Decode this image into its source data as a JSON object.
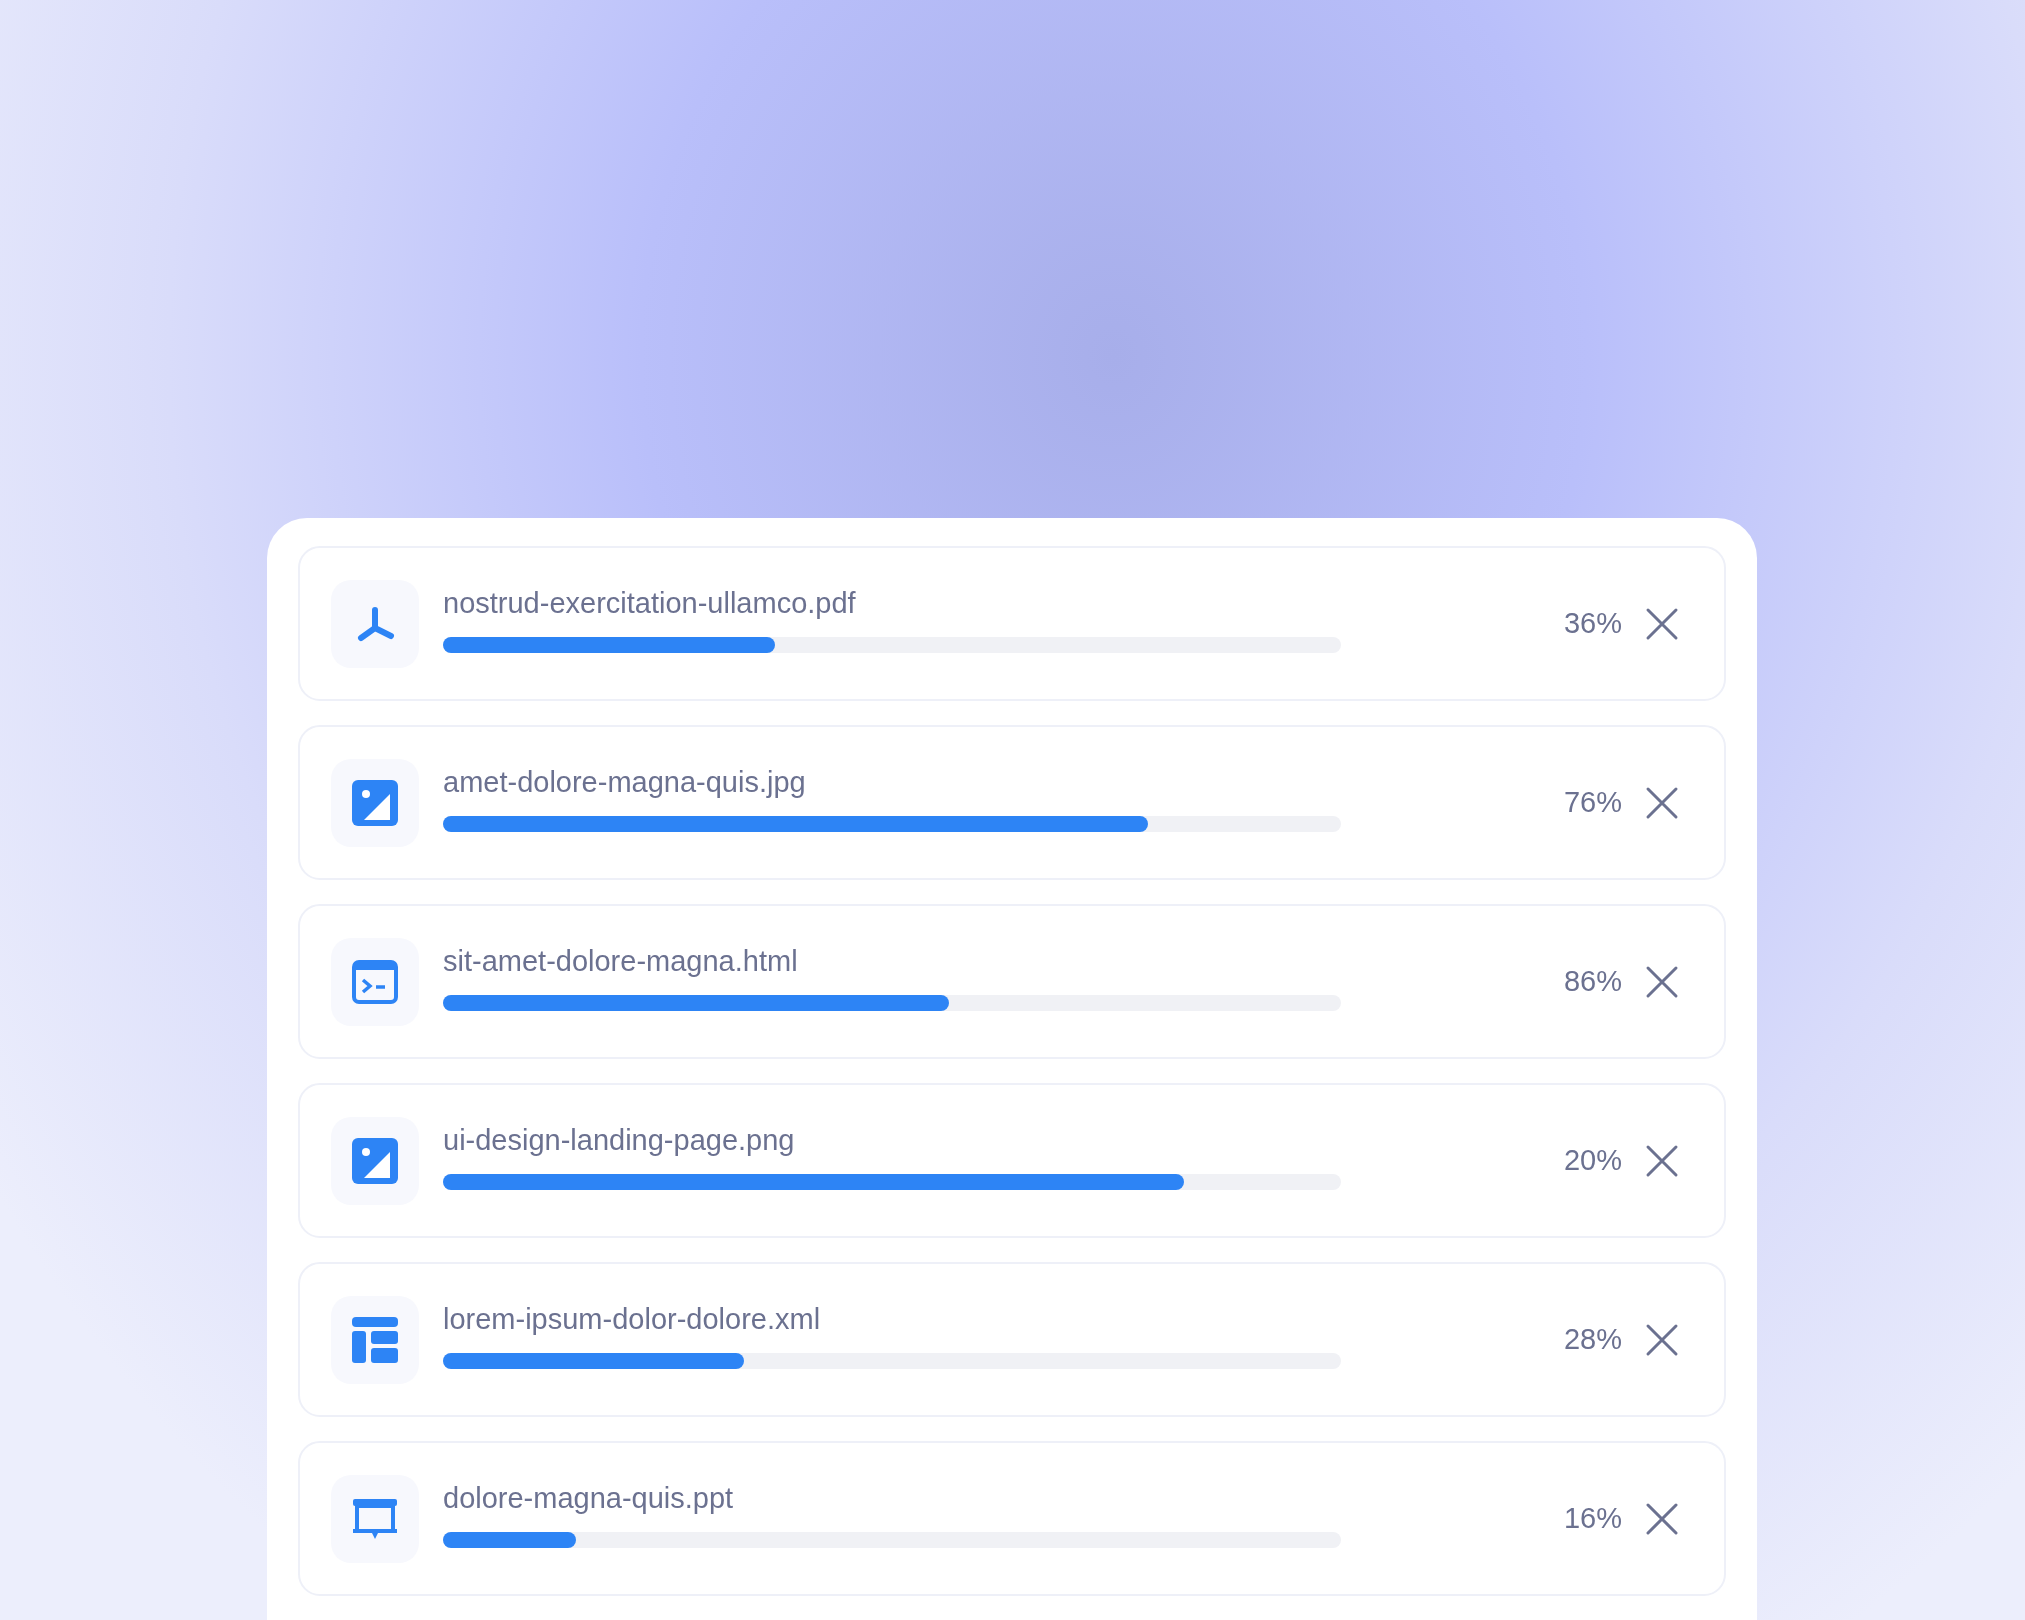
{
  "uploads": [
    {
      "kind": "pdf",
      "name": "nostrud-exercitation-ullamco.pdf",
      "level": 0.37,
      "percent": "36%"
    },
    {
      "kind": "image",
      "name": "amet-dolore-magna-quis.jpg",
      "level": 0.785,
      "percent": "76%"
    },
    {
      "kind": "code",
      "name": "sit-amet-dolore-magna.html",
      "level": 0.563,
      "percent": "86%"
    },
    {
      "kind": "image",
      "name": "ui-design-landing-page.png",
      "level": 0.825,
      "percent": "20%"
    },
    {
      "kind": "layout",
      "name": "lorem-ipsum-dolor-dolore.xml",
      "level": 0.335,
      "percent": "28%"
    },
    {
      "kind": "presentation",
      "name": "dolore-magna-quis.ppt",
      "level": 0.148,
      "percent": "16%"
    }
  ]
}
